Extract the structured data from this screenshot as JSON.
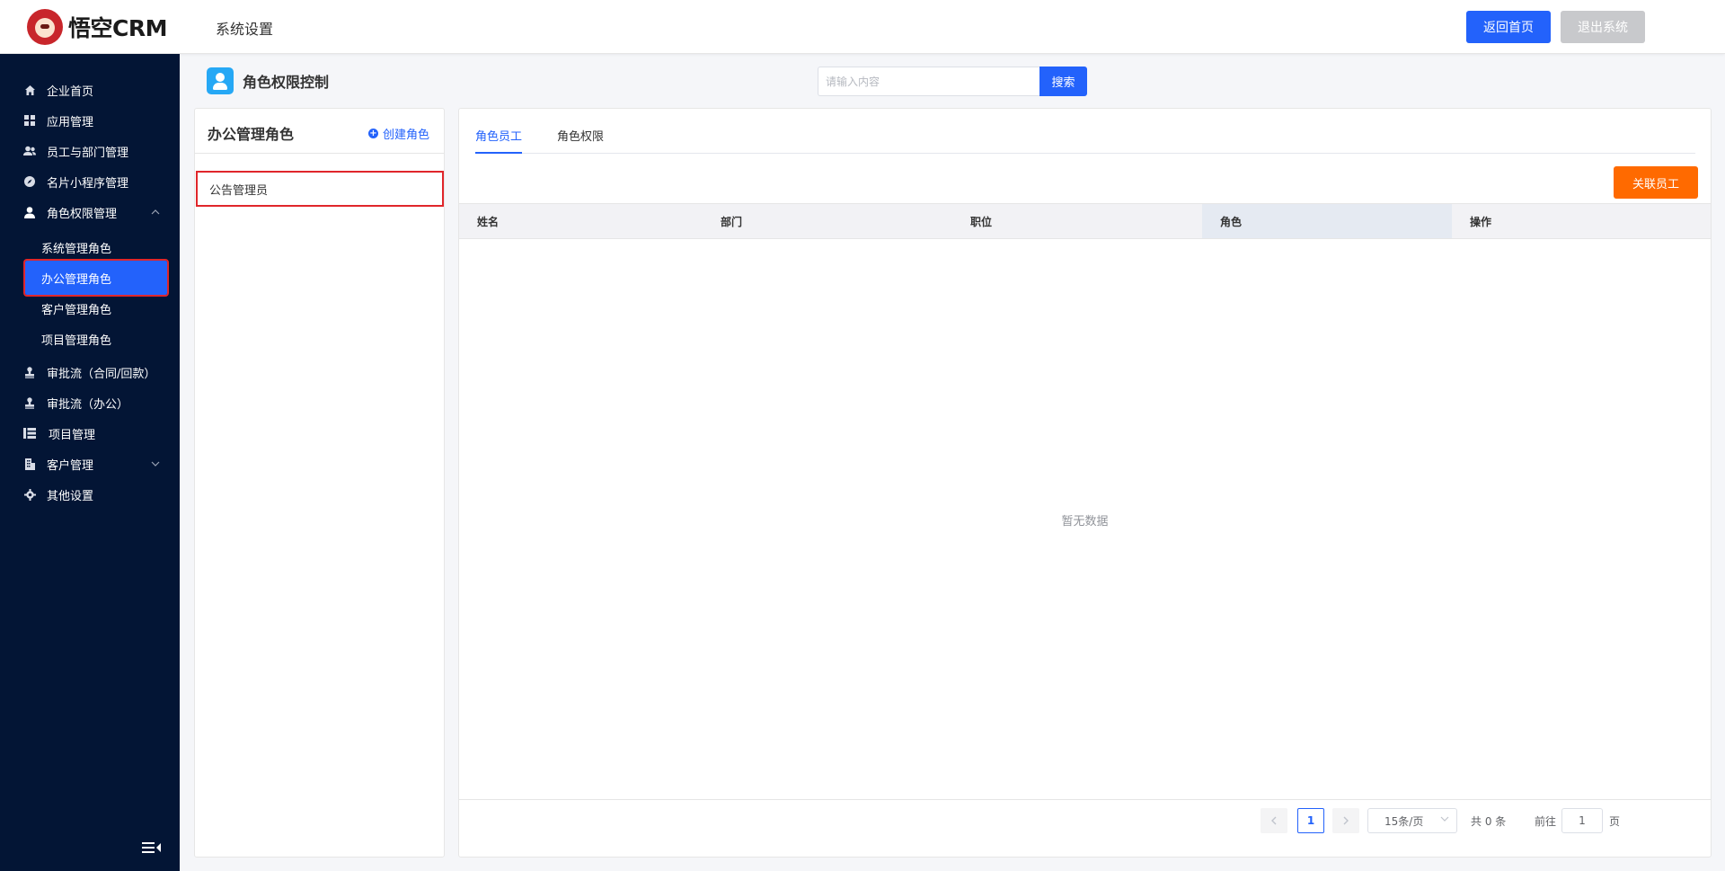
{
  "header": {
    "logo_text": "悟空CRM",
    "title": "系统设置",
    "home_button": "返回首页",
    "exit_button": "退出系统"
  },
  "sidebar": {
    "items": [
      {
        "label": "企业首页",
        "icon": "home-icon"
      },
      {
        "label": "应用管理",
        "icon": "grid-icon"
      },
      {
        "label": "员工与部门管理",
        "icon": "users-icon"
      },
      {
        "label": "名片小程序管理",
        "icon": "compass-icon"
      },
      {
        "label": "角色权限管理",
        "icon": "user-icon",
        "expanded": true
      },
      {
        "label": "审批流（合同/回款）",
        "icon": "stamp-icon"
      },
      {
        "label": "审批流（办公）",
        "icon": "stamp-icon"
      },
      {
        "label": "项目管理",
        "icon": "list-icon"
      },
      {
        "label": "客户管理",
        "icon": "building-icon"
      },
      {
        "label": "其他设置",
        "icon": "gear-icon"
      }
    ],
    "subitems": [
      {
        "label": "系统管理角色"
      },
      {
        "label": "办公管理角色",
        "active": true
      },
      {
        "label": "客户管理角色"
      },
      {
        "label": "项目管理角色"
      }
    ]
  },
  "page": {
    "title": "角色权限控制",
    "search_placeholder": "请输入内容",
    "search_button": "搜索"
  },
  "role_panel": {
    "title": "办公管理角色",
    "create_label": "创建角色",
    "roles": [
      "公告管理员"
    ]
  },
  "main": {
    "tabs": [
      {
        "label": "角色员工",
        "active": true
      },
      {
        "label": "角色权限",
        "active": false
      }
    ],
    "link_staff_button": "关联员工",
    "columns": [
      "姓名",
      "部门",
      "职位",
      "角色",
      "操作"
    ],
    "empty_text": "暂无数据"
  },
  "pagination": {
    "current_page": "1",
    "page_size": "15条/页",
    "total": "共 0 条",
    "goto_label": "前往",
    "goto_value": "1",
    "goto_suffix": "页"
  },
  "colors": {
    "primary": "#2362fb",
    "sidebar_bg": "#031535",
    "accent_orange": "#ff6a00",
    "highlight_red": "#e0262b"
  }
}
